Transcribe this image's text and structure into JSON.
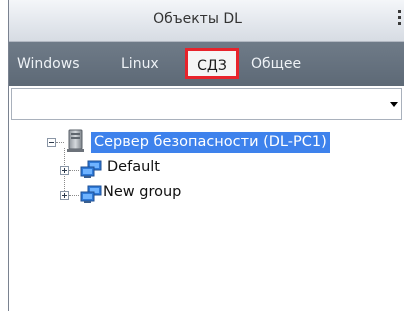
{
  "panel": {
    "title": "Объекты DL"
  },
  "tabs": [
    {
      "label": "Windows",
      "selected": false
    },
    {
      "label": "Linux",
      "selected": false
    },
    {
      "label": "СДЗ",
      "selected": true,
      "highlight_color": "#e8232b"
    },
    {
      "label": "Общее",
      "selected": false
    }
  ],
  "filter_dropdown": {
    "value": ""
  },
  "tree": {
    "root": {
      "label": "Сервер безопасности (DL-PC1)",
      "icon": "server-icon",
      "selected": true,
      "expanded": true
    },
    "children": [
      {
        "label": "Default",
        "icon": "computer-group-icon",
        "expanded": false
      },
      {
        "label": "New group",
        "icon": "computer-group-icon",
        "expanded": false
      }
    ]
  },
  "colors": {
    "tabbar": "#65717e",
    "selection": "#3e82ec",
    "tab_highlight": "#e8232b"
  }
}
